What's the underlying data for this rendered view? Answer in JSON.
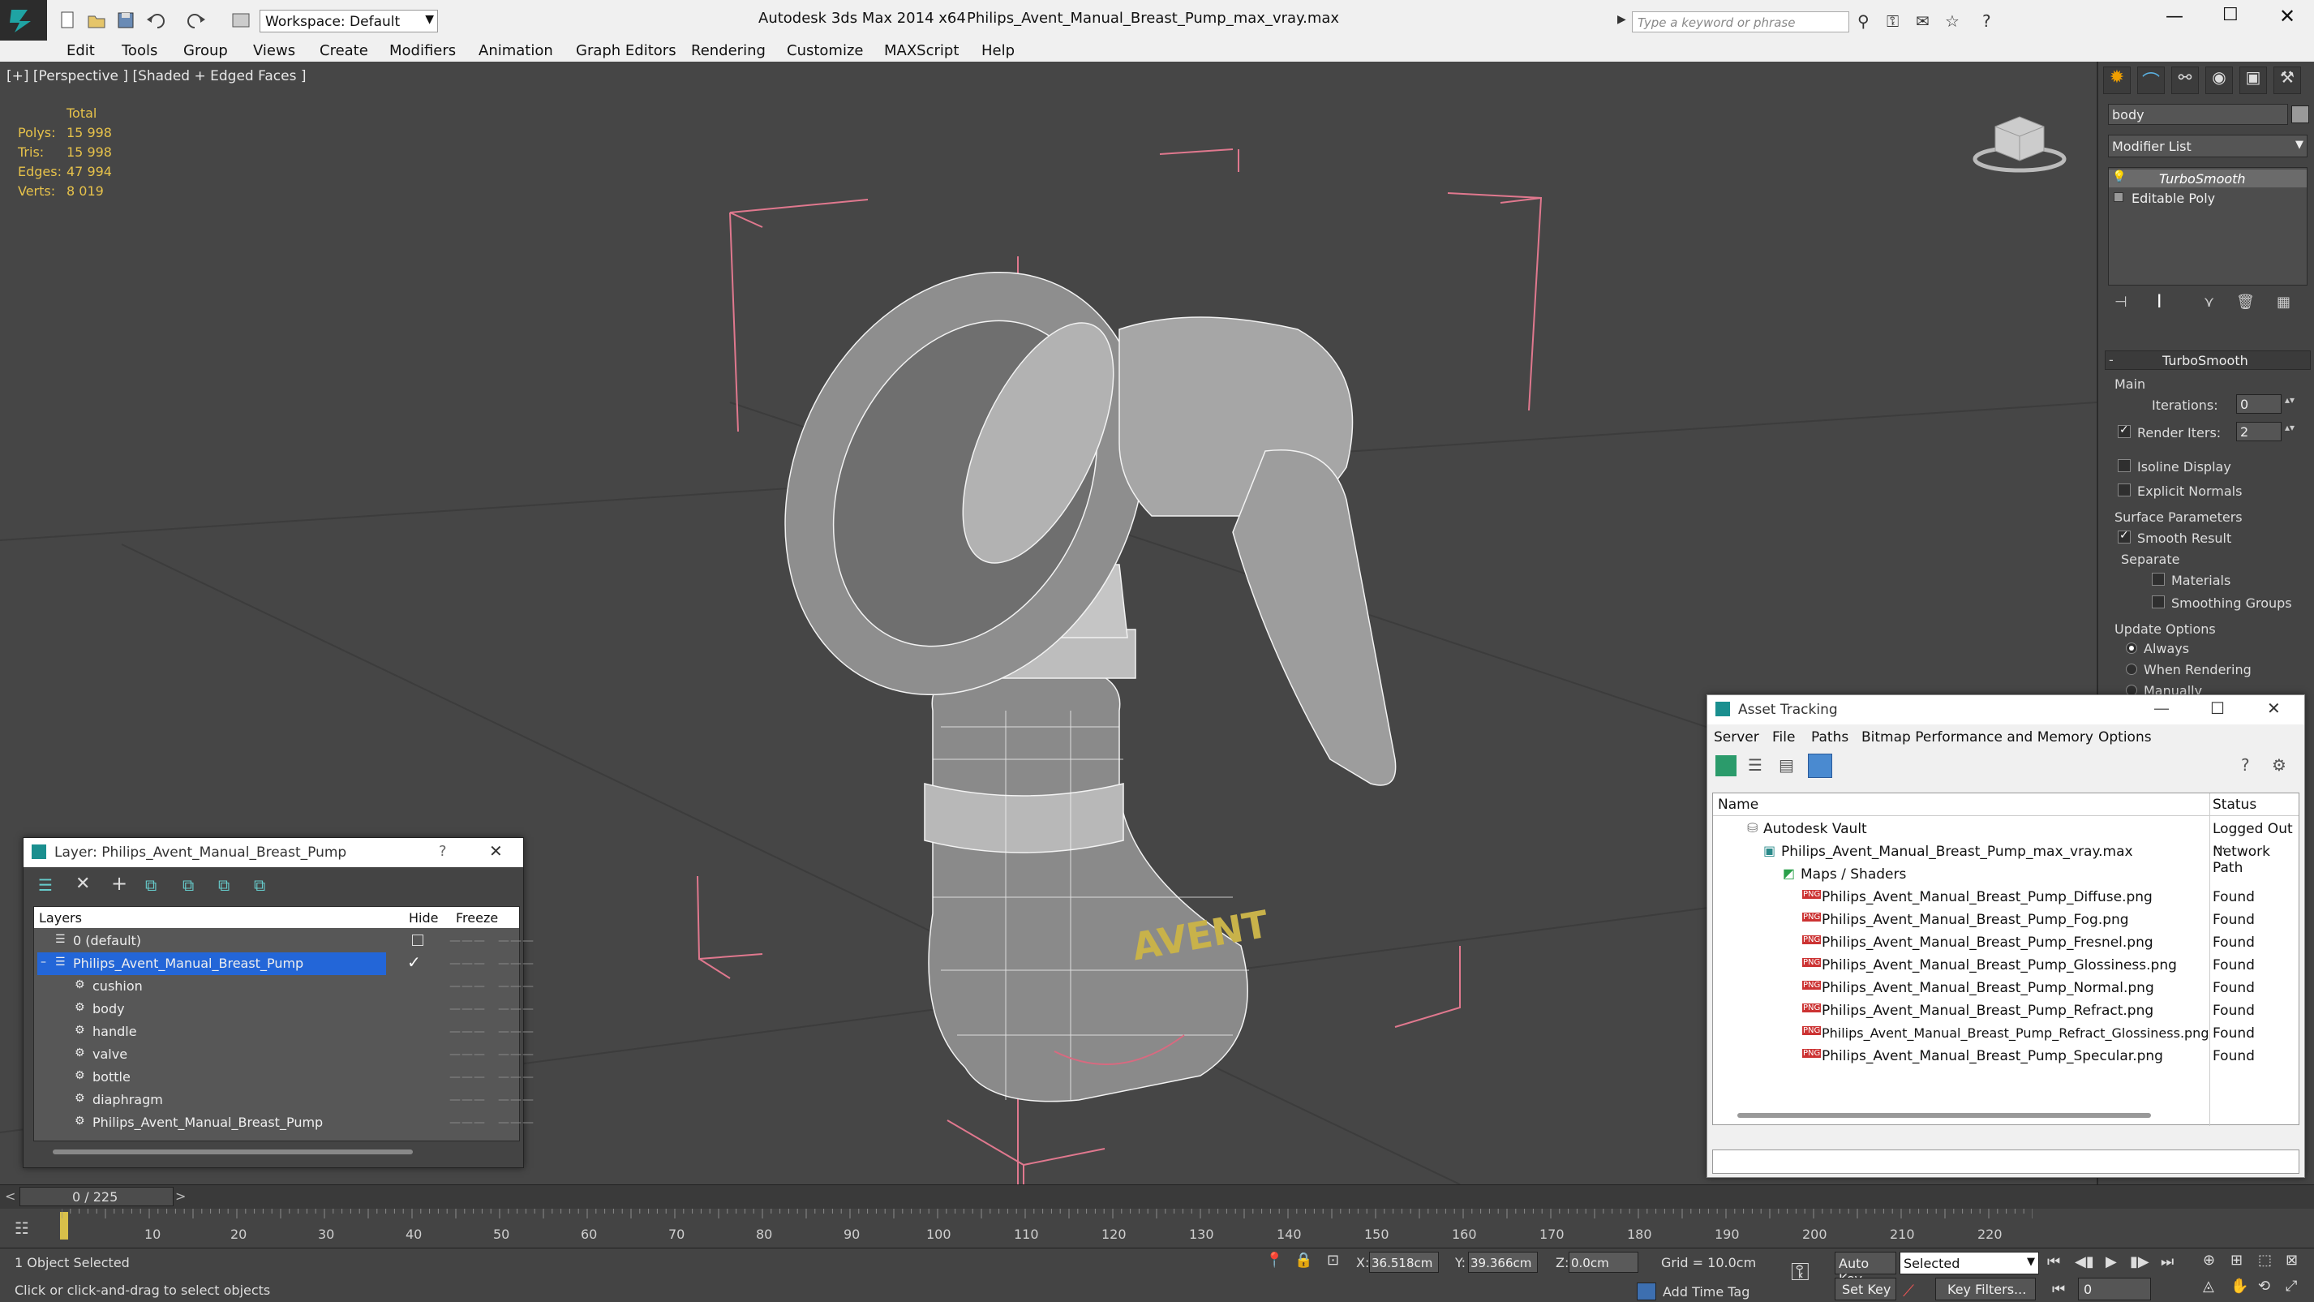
{
  "titlebar": {
    "workspace_label": "Workspace: Default",
    "app_title": "Autodesk 3ds Max  2014 x64",
    "file_title": "Philips_Avent_Manual_Breast_Pump_max_vray.max",
    "search_placeholder": "Type a keyword or phrase"
  },
  "menu": [
    "Edit",
    "Tools",
    "Group",
    "Views",
    "Create",
    "Modifiers",
    "Animation",
    "Graph Editors",
    "Rendering",
    "Customize",
    "MAXScript",
    "Help"
  ],
  "viewport": {
    "label": "[+] [Perspective ] [Shaded + Edged Faces ]",
    "stats": {
      "header": "Total",
      "polys_label": "Polys:",
      "polys": "15 998",
      "tris_label": "Tris:",
      "tris": "15 998",
      "edges_label": "Edges:",
      "edges": "47 994",
      "verts_label": "Verts:",
      "verts": "8 019"
    },
    "logo_text": "AVENT"
  },
  "command_panel": {
    "object_name": "body",
    "modifier_list": "Modifier List",
    "stack": [
      "TurboSmooth",
      "Editable Poly"
    ],
    "rollout_title": "TurboSmooth",
    "main_label": "Main",
    "iterations_label": "Iterations:",
    "iterations": "0",
    "render_iters_label": "Render Iters:",
    "render_iters": "2",
    "isoline": "Isoline Display",
    "explicit_normals": "Explicit Normals",
    "surface_params": "Surface Parameters",
    "smooth_result": "Smooth Result",
    "separate": "Separate",
    "materials": "Materials",
    "smoothing_groups": "Smoothing Groups",
    "update_options": "Update Options",
    "always": "Always",
    "when_rendering": "When Rendering",
    "manually": "Manually"
  },
  "layer_window": {
    "title": "Layer: Philips_Avent_Manual_Breast_Pump",
    "help": "?",
    "col_layers": "Layers",
    "col_hide": "Hide",
    "col_freeze": "Freeze",
    "rows": [
      "0 (default)",
      "Philips_Avent_Manual_Breast_Pump",
      "cushion",
      "body",
      "handle",
      "valve",
      "bottle",
      "diaphragm",
      "Philips_Avent_Manual_Breast_Pump"
    ]
  },
  "asset_window": {
    "title": "Asset Tracking",
    "menu": [
      "Server",
      "File",
      "Paths",
      "Bitmap Performance and Memory",
      "Options"
    ],
    "col_name": "Name",
    "col_status": "Status",
    "rows": [
      {
        "name": "Autodesk Vault",
        "status": "Logged Out ..."
      },
      {
        "name": "Philips_Avent_Manual_Breast_Pump_max_vray.max",
        "status": "Network Path"
      },
      {
        "name": "Maps / Shaders",
        "status": ""
      },
      {
        "name": "Philips_Avent_Manual_Breast_Pump_Diffuse.png",
        "status": "Found"
      },
      {
        "name": "Philips_Avent_Manual_Breast_Pump_Fog.png",
        "status": "Found"
      },
      {
        "name": "Philips_Avent_Manual_Breast_Pump_Fresnel.png",
        "status": "Found"
      },
      {
        "name": "Philips_Avent_Manual_Breast_Pump_Glossiness.png",
        "status": "Found"
      },
      {
        "name": "Philips_Avent_Manual_Breast_Pump_Normal.png",
        "status": "Found"
      },
      {
        "name": "Philips_Avent_Manual_Breast_Pump_Refract.png",
        "status": "Found"
      },
      {
        "name": "Philips_Avent_Manual_Breast_Pump_Refract_Glossiness.png",
        "status": "Found"
      },
      {
        "name": "Philips_Avent_Manual_Breast_Pump_Specular.png",
        "status": "Found"
      }
    ]
  },
  "timeline": {
    "frame_counter": "0 / 225",
    "ticks": [
      "10",
      "20",
      "30",
      "40",
      "50",
      "60",
      "70",
      "80",
      "90",
      "100",
      "110",
      "120",
      "130",
      "140",
      "150",
      "160",
      "170",
      "180",
      "190",
      "200",
      "210",
      "220"
    ]
  },
  "status": {
    "selection": "1 Object Selected",
    "prompt": "Click or click-and-drag to select objects",
    "x_label": "X:",
    "x": "36.518cm",
    "y_label": "Y:",
    "y": "39.366cm",
    "z_label": "Z:",
    "z": "0.0cm",
    "grid": "Grid = 10.0cm",
    "auto_key": "Auto Key",
    "selected_dropdown": "Selected",
    "set_key": "Set Key",
    "key_filters": "Key Filters...",
    "add_time_tag": "Add Time Tag",
    "frame_field": "0"
  }
}
